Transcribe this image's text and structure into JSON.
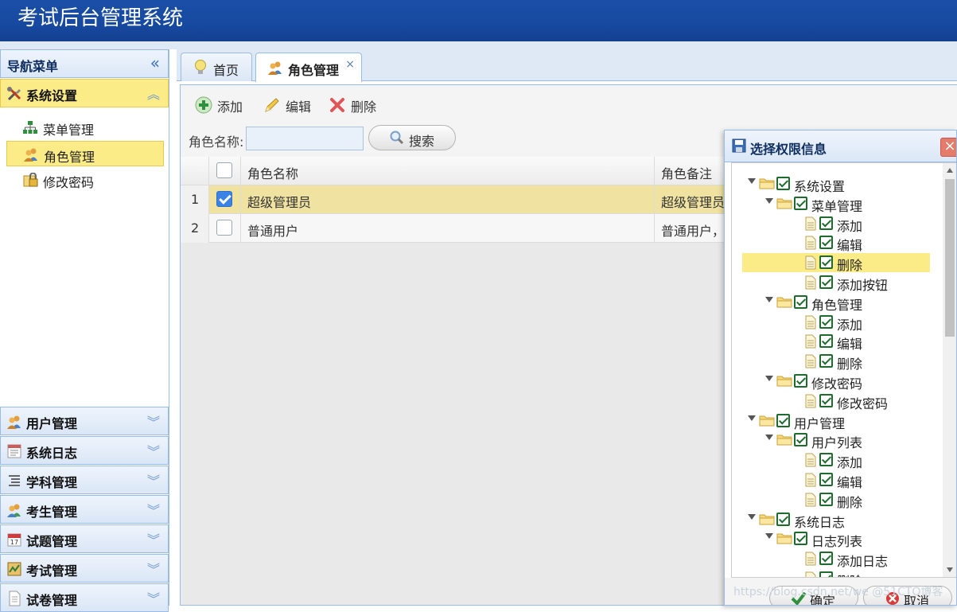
{
  "app": {
    "title": "考试后台管理系统"
  },
  "sidebar": {
    "header": "导航菜单",
    "collapse_glyph": "«",
    "active_group": {
      "label": "系统设置",
      "icon": "tools-icon",
      "chevron": "︽"
    },
    "sub_items": [
      {
        "label": "菜单管理",
        "icon": "sitemap-icon"
      },
      {
        "label": "角色管理",
        "icon": "users-icon",
        "selected": true
      },
      {
        "label": "修改密码",
        "icon": "lock-icon"
      }
    ],
    "groups": [
      {
        "label": "用户管理",
        "icon": "users-icon"
      },
      {
        "label": "系统日志",
        "icon": "log-icon"
      },
      {
        "label": "学科管理",
        "icon": "list-icon"
      },
      {
        "label": "考生管理",
        "icon": "users-icon"
      },
      {
        "label": "试题管理",
        "icon": "calendar-icon"
      },
      {
        "label": "考试管理",
        "icon": "map-icon"
      },
      {
        "label": "试卷管理",
        "icon": "document-icon"
      }
    ],
    "group_chevron": "︾"
  },
  "tabs": [
    {
      "label": "首页",
      "icon": "lightbulb-icon"
    },
    {
      "label": "角色管理",
      "icon": "users-icon",
      "active": true,
      "close": "×"
    }
  ],
  "toolbar": {
    "add_label": "添加",
    "edit_label": "编辑",
    "delete_label": "删除"
  },
  "search": {
    "label": "角色名称:",
    "value": "",
    "button_label": "搜索"
  },
  "grid": {
    "columns": [
      "角色名称",
      "角色备注"
    ],
    "rows": [
      {
        "num": "1",
        "checked": true,
        "name": "超级管理员",
        "remark": "超级管理员"
      },
      {
        "num": "2",
        "checked": false,
        "name": "普通用户",
        "remark": "普通用户，"
      }
    ]
  },
  "dialog": {
    "title": "选择权限信息",
    "close_glyph": "×",
    "tree": [
      {
        "label": "系统设置",
        "level": 0,
        "type": "folder"
      },
      {
        "label": "菜单管理",
        "level": 1,
        "type": "folder"
      },
      {
        "label": "添加",
        "level": 2,
        "type": "file"
      },
      {
        "label": "编辑",
        "level": 2,
        "type": "file"
      },
      {
        "label": "删除",
        "level": 2,
        "type": "file",
        "highlight": true
      },
      {
        "label": "添加按钮",
        "level": 2,
        "type": "file"
      },
      {
        "label": "角色管理",
        "level": 1,
        "type": "folder"
      },
      {
        "label": "添加",
        "level": 2,
        "type": "file"
      },
      {
        "label": "编辑",
        "level": 2,
        "type": "file"
      },
      {
        "label": "删除",
        "level": 2,
        "type": "file"
      },
      {
        "label": "修改密码",
        "level": 1,
        "type": "folder"
      },
      {
        "label": "修改密码",
        "level": 2,
        "type": "file"
      },
      {
        "label": "用户管理",
        "level": 0,
        "type": "folder"
      },
      {
        "label": "用户列表",
        "level": 1,
        "type": "folder"
      },
      {
        "label": "添加",
        "level": 2,
        "type": "file"
      },
      {
        "label": "编辑",
        "level": 2,
        "type": "file"
      },
      {
        "label": "删除",
        "level": 2,
        "type": "file"
      },
      {
        "label": "系统日志",
        "level": 0,
        "type": "folder"
      },
      {
        "label": "日志列表",
        "level": 1,
        "type": "folder"
      },
      {
        "label": "添加日志",
        "level": 2,
        "type": "file"
      },
      {
        "label": "删除",
        "level": 2,
        "type": "file"
      }
    ],
    "ok_label": "确定",
    "cancel_label": "取消"
  },
  "watermark": "https://blog.csdn.net/we @51CTO博客"
}
